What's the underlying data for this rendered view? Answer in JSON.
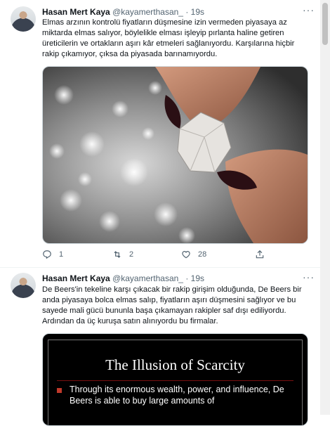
{
  "tweets": [
    {
      "name": "Hasan Mert Kaya",
      "handle": "@kayamerthasan_",
      "dot": "·",
      "time": "19s",
      "more": "···",
      "text": "Elmas arzının kontrolü fiyatların düşmesine izin vermeden piyasaya az miktarda elmas salıyor, böylelikle elması işleyip pırlanta haline getiren üreticilerin ve ortakların aşırı kâr etmeleri sağlanıyordu. Karşılarına hiçbir rakip çıkamıyor, çıksa da piyasada barınamıyordu.",
      "replies": "1",
      "retweets": "2",
      "likes": "28"
    },
    {
      "name": "Hasan Mert Kaya",
      "handle": "@kayamerthasan_",
      "dot": "·",
      "time": "19s",
      "more": "···",
      "text": "De Beers'in tekeline karşı çıkacak bir rakip girişim olduğunda, De Beers bir anda piyasaya bolca elmas salıp, fiyatların aşırı düşmesini sağlıyor ve bu sayede mali gücü bununla başa çıkamayan rakipler saf dışı ediliyordu. Ardından da üç kuruşa satın alınıyordu bu firmalar.",
      "slide_title": "The Illusion of Scarcity",
      "slide_bullet": "Through its enormous wealth, power, and influence, De Beers is able to buy large amounts of"
    }
  ],
  "colors": {
    "accent": "#1d9bf0",
    "muted": "#536471",
    "slide_bg": "#000000",
    "bullet": "#c0392b"
  },
  "icons": [
    "reply-icon",
    "retweet-icon",
    "like-icon",
    "share-icon",
    "more-icon"
  ]
}
